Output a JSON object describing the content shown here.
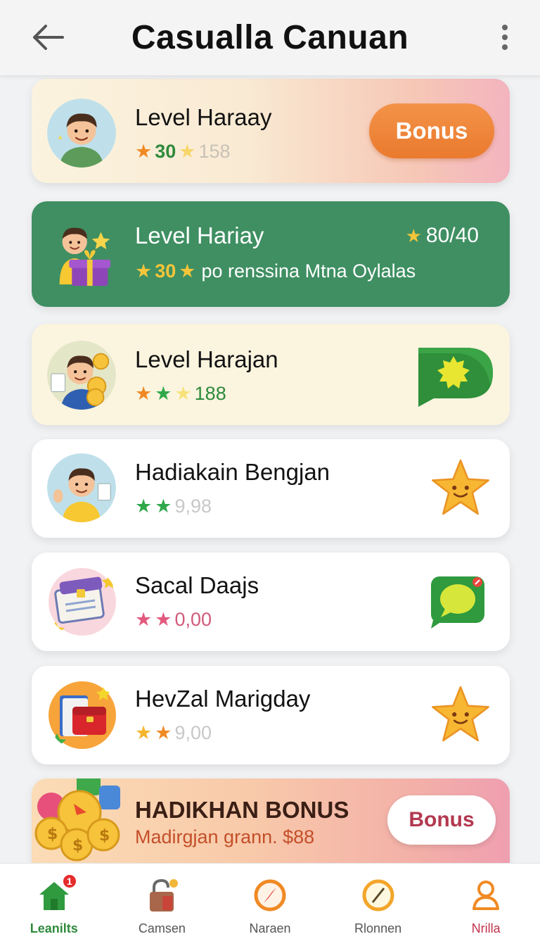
{
  "header": {
    "title": "Casualla Canuan",
    "back_icon": "arrow-left-icon",
    "menu_icon": "more-vertical-icon"
  },
  "cards": [
    {
      "name": "Level Haraay",
      "stat_primary": "30",
      "stat_secondary": "158",
      "action_label": "Bonus",
      "action_color": "#ec7f33"
    },
    {
      "name": "Level Hariay",
      "stat_primary": "30",
      "subtitle": "po renssina Mtna Oylalas",
      "progress": "80/40",
      "background": "#3f8f62"
    },
    {
      "name": "Level Harajan",
      "stat_value": "188",
      "right_icon": "green-chat-badge-icon"
    },
    {
      "name": "Hadiakain Bengjan",
      "stat_value": "9,98",
      "right_icon": "smiling-star-icon"
    },
    {
      "name": "Sacal Daajs",
      "stat_value": "0,00",
      "right_icon": "green-chat-bubble-icon"
    },
    {
      "name": "HevZal Marigday",
      "stat_value": "9,00",
      "right_icon": "smiling-star-icon"
    }
  ],
  "promo": {
    "title": "HADIKHAN BONUS",
    "subtitle": "Madirgjan grann. $88",
    "action_label": "Bonus",
    "action_text_color": "#b2384f"
  },
  "bottom_nav": {
    "items": [
      {
        "label": "Leanilts",
        "icon": "home-icon",
        "badge": "1",
        "active": true
      },
      {
        "label": "Camsen",
        "icon": "lock-icon"
      },
      {
        "label": "Naraen",
        "icon": "compass-icon"
      },
      {
        "label": "Rlonnen",
        "icon": "compass-icon"
      },
      {
        "label": "Nrilla",
        "icon": "profile-icon"
      }
    ]
  },
  "colors": {
    "star_gold": "#f5b52c",
    "star_orange": "#f08a24",
    "star_green": "#2fa84a",
    "star_pink": "#e35a7f",
    "nav_active": "#2f8a3c"
  }
}
